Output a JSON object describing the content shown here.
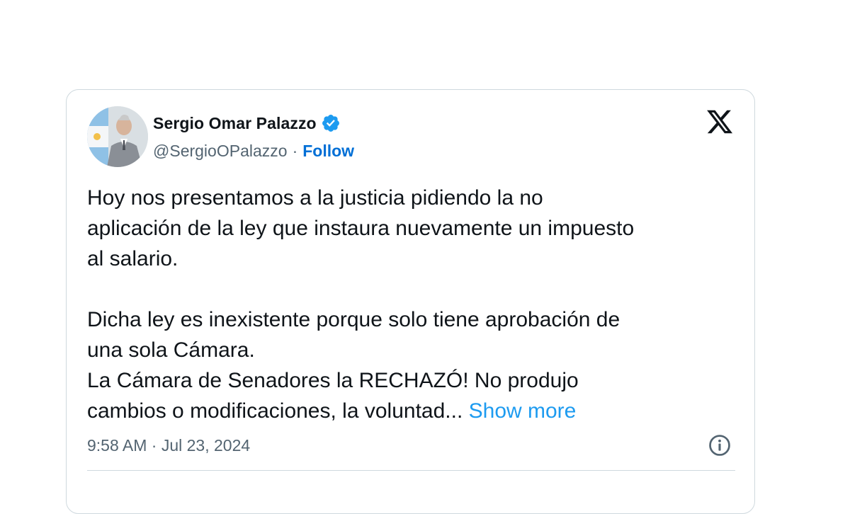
{
  "tweet": {
    "author": {
      "display_name": "Sergio Omar Palazzo",
      "handle": "@SergioOPalazzo",
      "separator": "·",
      "follow_label": "Follow",
      "verified": true
    },
    "text": {
      "line1": "Hoy nos presentamos a la justicia pidiendo la no",
      "line2": "aplicación de la ley que instaura nuevamente un impuesto",
      "line3": "al salario.",
      "line4": "Dicha ley es inexistente porque solo tiene aprobación de",
      "line5": "una sola Cámara.",
      "line6": "La Cámara de Senadores la RECHAZÓ! No produjo",
      "line7": "cambios o modificaciones, la voluntad...",
      "show_more": "Show more"
    },
    "timestamp": "9:58 AM · Jul 23, 2024"
  },
  "icons": {
    "brand": "x-logo-icon",
    "verified": "verified-badge-icon",
    "info": "info-icon"
  },
  "colors": {
    "text_primary": "#0f1419",
    "text_secondary": "#536471",
    "follow_blue": "#006fd6",
    "link_blue": "#1d9bf0",
    "border": "#cfd9de"
  }
}
